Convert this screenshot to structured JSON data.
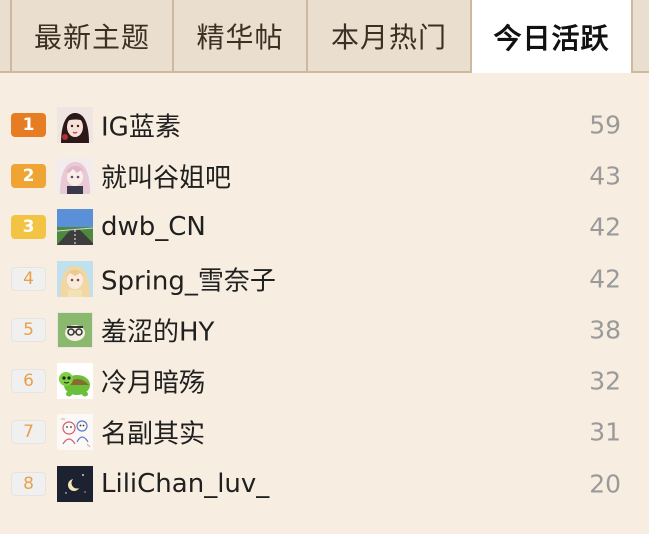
{
  "tabs": [
    {
      "label": "最新主题",
      "active": false
    },
    {
      "label": "精华帖",
      "active": false
    },
    {
      "label": "本月热门",
      "active": false
    },
    {
      "label": "今日活跃",
      "active": true
    }
  ],
  "rows": [
    {
      "rank": "1",
      "name": "IG蓝素",
      "count": "59",
      "avatar": "avatar-dark-hair-girl"
    },
    {
      "rank": "2",
      "name": "就叫谷姐吧",
      "count": "43",
      "avatar": "avatar-pink-hair-anime"
    },
    {
      "rank": "3",
      "name": "dwb_CN",
      "count": "42",
      "avatar": "avatar-road-landscape"
    },
    {
      "rank": "4",
      "name": "Spring_雪奈子",
      "count": "42",
      "avatar": "avatar-blonde-anime"
    },
    {
      "rank": "5",
      "name": "羞涩的HY",
      "count": "38",
      "avatar": "avatar-green-glasses"
    },
    {
      "rank": "6",
      "name": "冷月暗殇",
      "count": "32",
      "avatar": "avatar-green-turtle"
    },
    {
      "rank": "7",
      "name": "名副其实",
      "count": "31",
      "avatar": "avatar-sketch-characters"
    },
    {
      "rank": "8",
      "name": "LiliChan_luv_",
      "count": "20",
      "avatar": "avatar-night-moon"
    }
  ],
  "colors": {
    "rank1": "#e67d22",
    "rank2": "#efa433",
    "rank3": "#f3c443",
    "rank_other_text": "#e8a04b",
    "count_text": "#9a9a9a"
  }
}
